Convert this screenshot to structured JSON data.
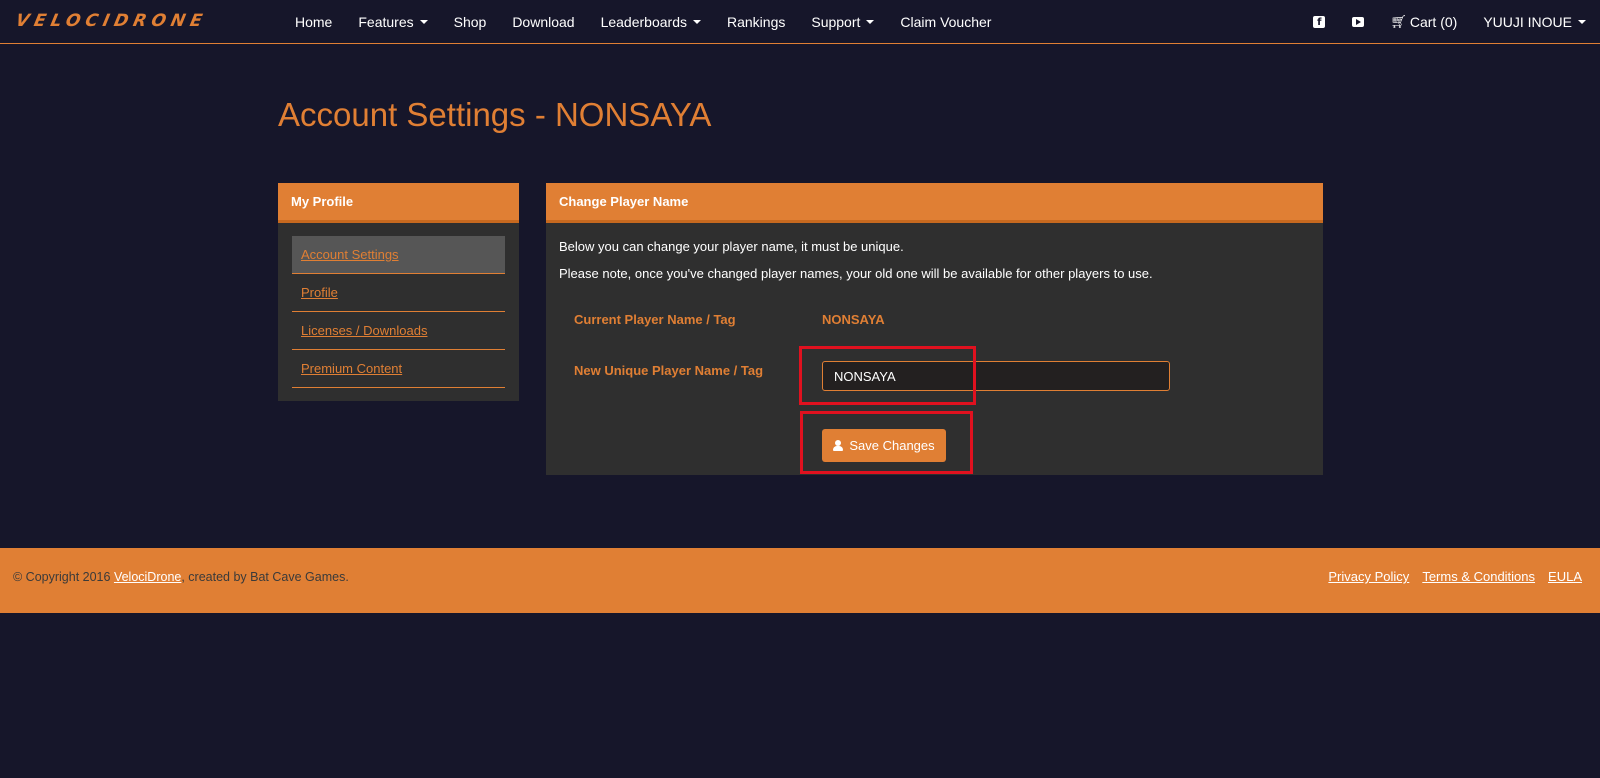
{
  "nav": {
    "brand": "VELOCIDRONE",
    "links": [
      "Home",
      "Features",
      "Shop",
      "Download",
      "Leaderboards",
      "Rankings",
      "Support",
      "Claim Voucher"
    ],
    "cart_label": "Cart (0)",
    "user_label": "YUUJI INOUE",
    "icons": [
      "facebook-icon",
      "youtube-icon",
      "cart-icon"
    ]
  },
  "page": {
    "title": "Account Settings - NONSAYA"
  },
  "sidebar": {
    "header": "My Profile",
    "items": [
      {
        "label": "Account Settings",
        "active": true
      },
      {
        "label": "Profile",
        "active": false
      },
      {
        "label": "Licenses / Downloads",
        "active": false
      },
      {
        "label": "Premium Content",
        "active": false
      }
    ]
  },
  "main": {
    "header": "Change Player Name",
    "desc1": "Below you can change your player name, it must be unique.",
    "desc2": "Please note, once you've changed player names, your old one will be available for other players to use.",
    "current_label": "Current Player Name / Tag",
    "current_value": "NONSAYA",
    "new_label": "New Unique Player Name / Tag",
    "new_value": "NONSAYA",
    "save_label": "Save Changes"
  },
  "footer": {
    "copyright_prefix": "© Copyright 2016",
    "copyright_link": "VelociDrone",
    "copyright_suffix": ", created by Bat Cave Games.",
    "links": [
      "Privacy Policy",
      "Terms & Conditions",
      "EULA"
    ]
  },
  "colors": {
    "accent": "#e07f34",
    "background": "#16162a",
    "panel": "#2f2f2f",
    "highlight": "#e0111f"
  }
}
